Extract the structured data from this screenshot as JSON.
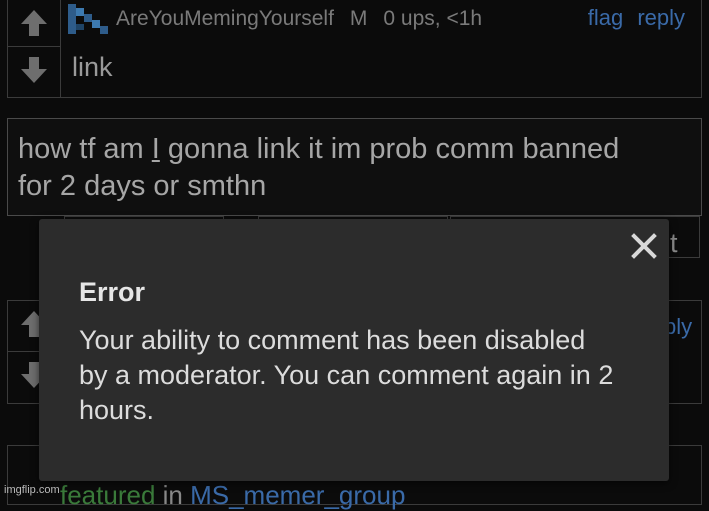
{
  "comment": {
    "author": "AreYouMemingYourself",
    "badge": "M",
    "stats": "0 ups, <1h",
    "flag_label": "flag",
    "reply_label": "reply",
    "text": "link"
  },
  "reply_box": {
    "line1_pre": "how tf am ",
    "line1_i": "I",
    "line1_post": " gonna link it im prob comm banned",
    "line2": "for 2 days or smthn"
  },
  "dialog": {
    "title": "Error",
    "message": "Your ability to comment has been disabled by a moderator. You can comment again in 2 hours."
  },
  "peek": {
    "submit_fragment": "t",
    "reply_fragment": "ply"
  },
  "footer": {
    "featured": "featured",
    "in_word": " in ",
    "group": "MS_memer_group"
  },
  "watermark": "imgflip.com",
  "colors": {
    "background": "#0b0b0b",
    "dialog_bg": "#2c2c2c",
    "link_blue": "#3a6aa8",
    "border": "#3b3b3b"
  },
  "icons": {
    "upvote": "arrow-up-icon",
    "downvote": "arrow-down-icon",
    "close": "close-icon",
    "avatar": "pixel-avatar-icon"
  }
}
